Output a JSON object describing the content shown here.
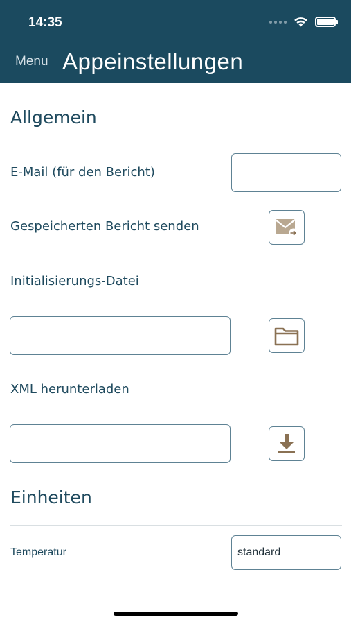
{
  "status_bar": {
    "time": "14:35"
  },
  "nav": {
    "menu_label": "Menu",
    "title": "Appeinstellungen"
  },
  "sections": {
    "general_title": "Allgemein",
    "units_title": "Einheiten"
  },
  "rows": {
    "email_label": "E-Mail (für den Bericht)",
    "email_value": "",
    "send_report_label": "Gespeicherten Bericht senden",
    "init_file_label": "Initialisierungs-Datei",
    "init_file_value": "",
    "xml_label": "XML herunterladen",
    "xml_value": "",
    "temperature_label": "Temperatur",
    "temperature_value": "standard"
  },
  "icons": {
    "send_report": "mail-forward-icon",
    "init_file": "folder-icon",
    "xml_download": "download-icon"
  },
  "colors": {
    "header_bg": "#1b4a5f",
    "text_primary": "#1f4a5e",
    "icon_tan": "#8a7153",
    "border": "#5e8294"
  }
}
